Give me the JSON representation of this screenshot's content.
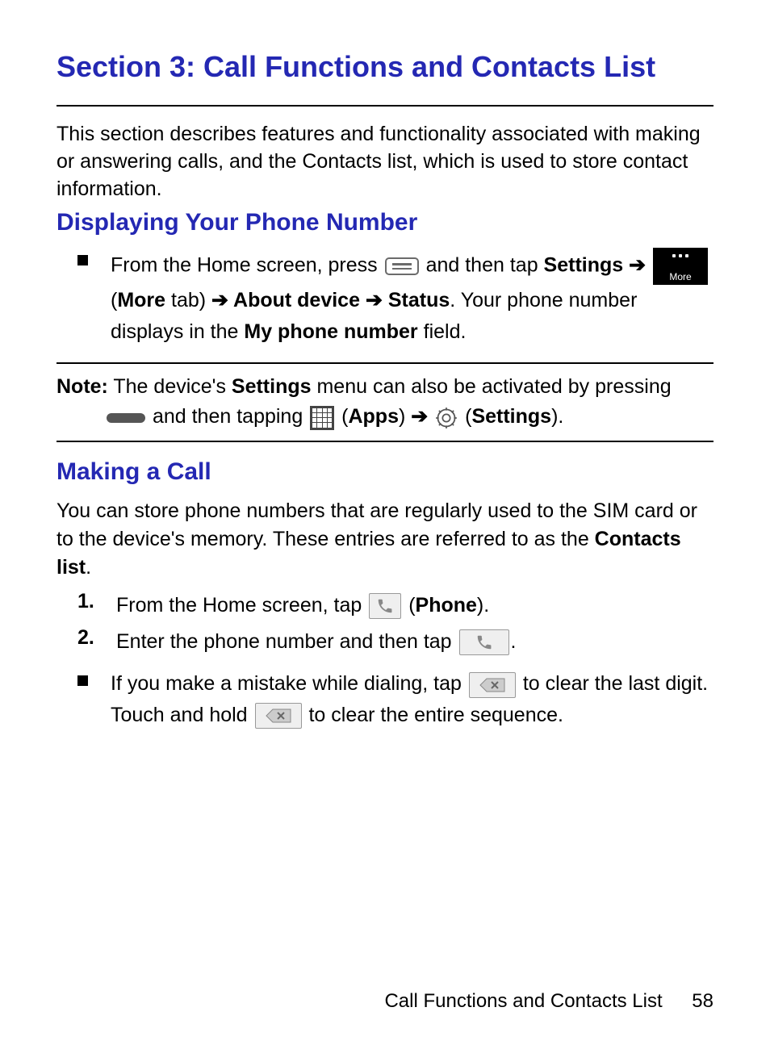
{
  "title": "Section 3: Call Functions and Contacts List",
  "intro": "This section describes features and functionality associated with making or answering calls, and the Contacts list, which is used to store contact information.",
  "sub1": "Displaying Your Phone Number",
  "display": {
    "t1": "From the Home screen, press ",
    "t2": " and then tap ",
    "settings": "Settings",
    "arrow": " ➔ ",
    "t3": " (",
    "more": "More",
    "t4": " tab) ",
    "about": "About device",
    "status": "Status",
    "t5": ". Your phone number displays in the ",
    "myphone": "My phone number",
    "t6": " field."
  },
  "note": {
    "label": "Note:",
    "t1": " The device's ",
    "settings": "Settings",
    "t2": " menu can also be activated by pressing ",
    "t3": " and then tapping ",
    "apps": "Apps",
    "arrow": " ➔ ",
    "settings2": "Settings",
    "close": ")."
  },
  "sub2": "Making a Call",
  "making_intro_1": "You can store phone numbers that are regularly used to the SIM card or to the device's memory. These entries are referred to as the ",
  "contacts_list": "Contacts list",
  "period": ".",
  "step1": {
    "num": "1.",
    "t1": "From the Home screen, tap ",
    "t2": " (",
    "phone": "Phone",
    "t3": ")."
  },
  "step2": {
    "num": "2.",
    "t1": "Enter the phone number and then tap ",
    "t2": "."
  },
  "mistake": {
    "t1": "If you make a mistake while dialing, tap ",
    "t2": " to clear the last digit. Touch and hold ",
    "t3": " to clear the entire sequence."
  },
  "more_icon_label": "More",
  "footer": {
    "title": "Call Functions and Contacts List",
    "page": "58"
  }
}
